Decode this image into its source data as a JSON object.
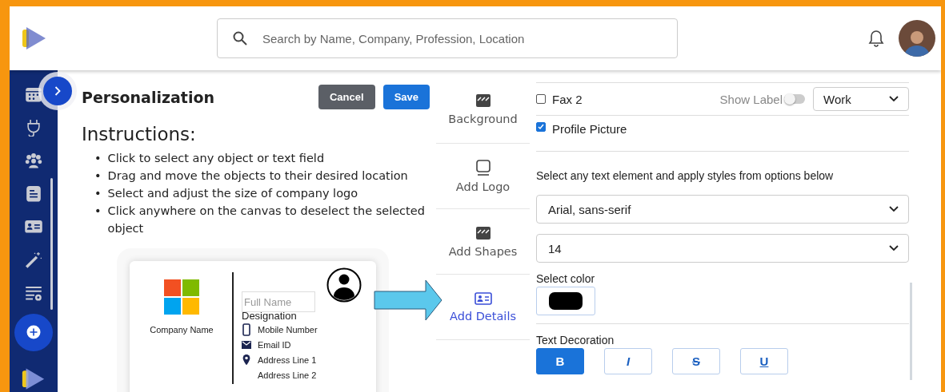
{
  "header": {
    "search": {
      "placeholder": "Search by Name, Company, Profession, Location"
    }
  },
  "editor": {
    "title": "Personalization",
    "buttons": [
      {
        "label": "Cancel",
        "kind": "secondary"
      },
      {
        "label": "Save",
        "kind": "primary"
      }
    ],
    "instructions_title": "Instructions:",
    "bullet": "•",
    "instructions": [
      "Click to select any object or text field",
      "Drag and move the objects to their desired location",
      "Select and adjust the size of company logo",
      "Click anywhere on the canvas to deselect the selected object"
    ]
  },
  "card": {
    "company_name": "Company Name",
    "full_name_placeholder": "Full Name",
    "designation": "Designation",
    "details": [
      {
        "kind": "phone",
        "text": "Mobile Number"
      },
      {
        "kind": "email",
        "text": "Email ID"
      },
      {
        "kind": "location",
        "text": "Address Line 1"
      },
      {
        "kind": "plain",
        "text": "Address Line 2"
      }
    ]
  },
  "tools": [
    {
      "kind": "background",
      "label": "Background",
      "selected": false
    },
    {
      "kind": "logo",
      "label": "Add Logo",
      "selected": false
    },
    {
      "kind": "shapes",
      "label": "Add Shapes",
      "selected": false
    },
    {
      "kind": "details",
      "label": "Add Details",
      "selected": true
    }
  ],
  "fields": [
    {
      "label": "Fax 2",
      "checked": false,
      "show_label": {
        "label": "Show Label",
        "on": false
      },
      "type": "Work"
    },
    {
      "label": "Profile Picture",
      "checked": true
    }
  ],
  "styles": {
    "hint": "Select any text element and apply styles from options below",
    "font": "Arial, sans-serif",
    "size": "14",
    "color_label": "Select color",
    "color": "#000000",
    "decoration_label": "Text Decoration",
    "decorations": [
      {
        "kind": "bold",
        "label": "B",
        "selected": true
      },
      {
        "kind": "italic",
        "label": "I",
        "selected": false
      },
      {
        "kind": "strike",
        "label": "S",
        "selected": false
      },
      {
        "kind": "underline",
        "label": "U",
        "selected": false
      }
    ]
  }
}
